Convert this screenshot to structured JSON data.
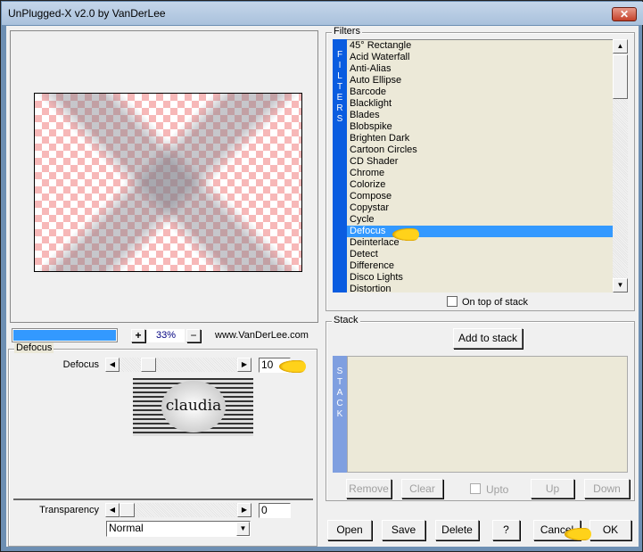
{
  "window": {
    "title": "UnPlugged-X v2.0 by VanDerLee",
    "close_label": "✕"
  },
  "preview": {
    "zoom": "33%",
    "plus": "+",
    "minus": "−",
    "website": "www.VanDerLee.com",
    "progress_percent": 100,
    "accent": "#3399ff"
  },
  "params": {
    "group_label": "Defocus",
    "defocus": {
      "label": "Defocus",
      "value": "10",
      "slider_fraction": 0.18
    },
    "transparency": {
      "label": "Transparency",
      "value": "0",
      "slider_fraction": 0.0
    },
    "blend_mode": "Normal",
    "logo_text": "claudia"
  },
  "filters": {
    "group_label": "Filters",
    "side_label": "FILTERS",
    "items": [
      "45° Rectangle",
      "Acid Waterfall",
      "Anti-Alias",
      "Auto Ellipse",
      "Barcode",
      "Blacklight",
      "Blades",
      "Blobspike",
      "Brighten Dark",
      "Cartoon Circles",
      "CD Shader",
      "Chrome",
      "Colorize",
      "Compose",
      "Copystar",
      "Cycle",
      "Defocus",
      "Deinterlace",
      "Detect",
      "Difference",
      "Disco Lights",
      "Distortion"
    ],
    "selected": "Defocus",
    "on_top_label": "On top of stack",
    "on_top_checked": false
  },
  "stack": {
    "group_label": "Stack",
    "side_label": "STACK",
    "add_label": "Add to stack",
    "remove": "Remove",
    "clear": "Clear",
    "upto": "Upto",
    "up": "Up",
    "down": "Down"
  },
  "buttons": {
    "open": "Open",
    "save": "Save",
    "delete": "Delete",
    "help": "?",
    "cancel": "Cancel",
    "ok": "OK"
  }
}
